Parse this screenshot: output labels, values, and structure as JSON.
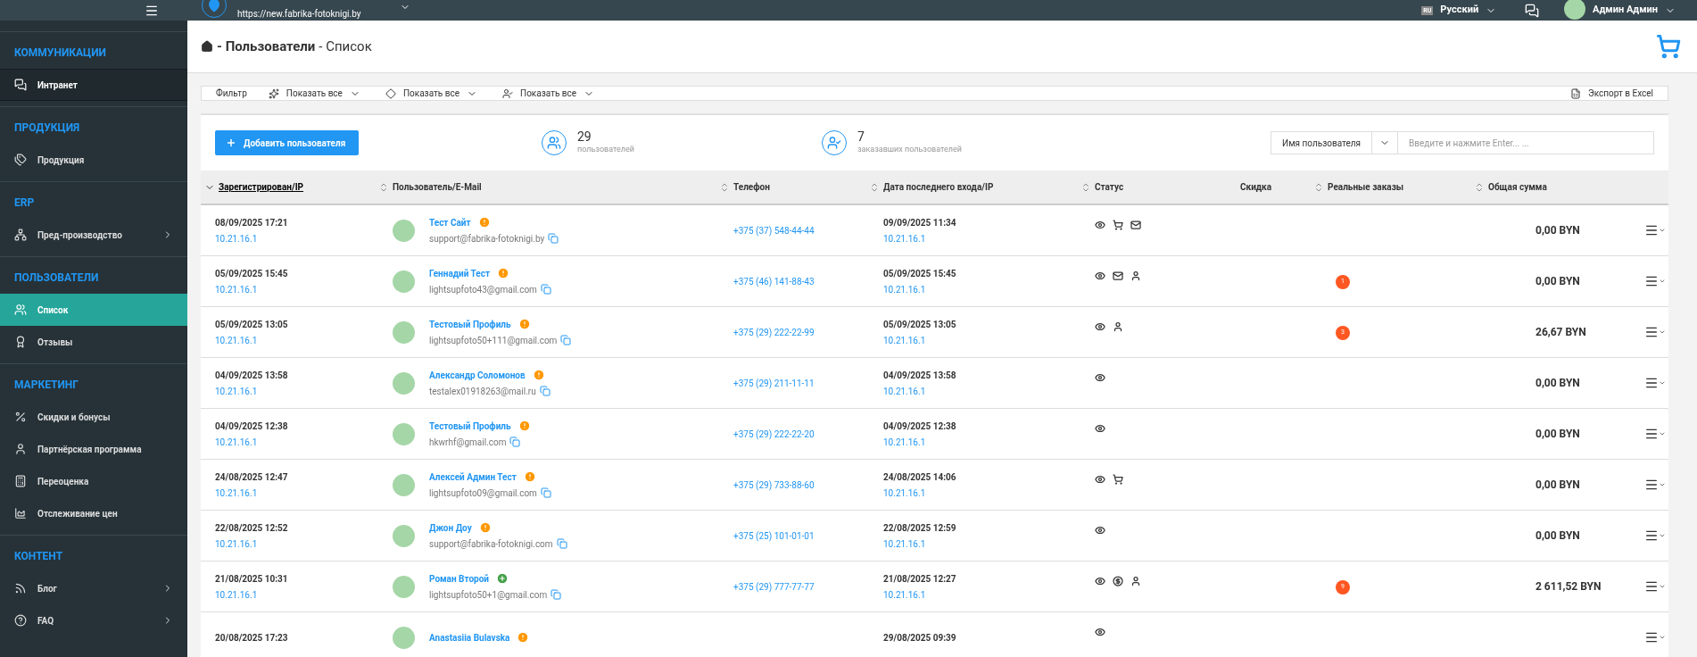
{
  "topbar": {
    "url": "https://new.fabrika-fotoknigi.by",
    "language_code": "RU",
    "language": "Русский",
    "user": "Админ Админ"
  },
  "sidebar": {
    "sections": [
      {
        "title": "КОММУНИКАЦИИ",
        "items": [
          {
            "label": "Интранет",
            "selected": false,
            "highlighted": true,
            "has_submenu": false
          }
        ]
      },
      {
        "title": "ПРОДУКЦИЯ",
        "items": [
          {
            "label": "Продукция",
            "selected": false,
            "highlighted": false,
            "has_submenu": false
          }
        ]
      },
      {
        "title": "ERP",
        "items": [
          {
            "label": "Пред-производство",
            "selected": false,
            "highlighted": false,
            "has_submenu": true
          }
        ]
      },
      {
        "title": "ПОЛЬЗОВАТЕЛИ",
        "items": [
          {
            "label": "Список",
            "selected": true,
            "highlighted": false,
            "has_submenu": false
          },
          {
            "label": "Отзывы",
            "selected": false,
            "highlighted": false,
            "has_submenu": false
          }
        ]
      },
      {
        "title": "МАРКЕТИНГ",
        "items": [
          {
            "label": "Скидки и бонусы",
            "selected": false,
            "highlighted": false,
            "has_submenu": false
          },
          {
            "label": "Партнёрская программа",
            "selected": false,
            "highlighted": false,
            "has_submenu": false
          },
          {
            "label": "Переоценка",
            "selected": false,
            "highlighted": false,
            "has_submenu": false
          },
          {
            "label": "Отслеживание цен",
            "selected": false,
            "highlighted": false,
            "has_submenu": false
          }
        ]
      },
      {
        "title": "КОНТЕНТ",
        "items": [
          {
            "label": "Блог",
            "selected": false,
            "highlighted": false,
            "has_submenu": true
          },
          {
            "label": "FAQ",
            "selected": false,
            "highlighted": false,
            "has_submenu": true
          }
        ]
      }
    ]
  },
  "breadcrumbs": [
    {
      "label": "- Пользователи",
      "current": false
    },
    {
      "label": "- Список",
      "current": true
    }
  ],
  "filter": {
    "label": "Фильтр",
    "dropdowns": [
      {
        "label": "Показать все"
      },
      {
        "label": "Показать все"
      },
      {
        "label": "Показать все"
      }
    ],
    "export": "Экспорт в Excel"
  },
  "add_button": "Добавить пользователя",
  "stats": [
    {
      "value": "29",
      "label": "пользователей"
    },
    {
      "value": "7",
      "label": "заказавших пользователей"
    }
  ],
  "search": {
    "field": "Имя пользователя",
    "placeholder": "Введите и нажмите Enter... ..."
  },
  "table": {
    "columns": [
      {
        "label": "Зарегистрирован/IP",
        "sortable": true,
        "sorted": true
      },
      {
        "label": "Пользователь/E-Mail",
        "sortable": true,
        "sorted": false
      },
      {
        "label": "Телефон",
        "sortable": true,
        "sorted": false
      },
      {
        "label": "Дата последнего входа/IP",
        "sortable": true,
        "sorted": false
      },
      {
        "label": "Статус",
        "sortable": true,
        "sorted": false
      },
      {
        "label": "Скидка",
        "sortable": false,
        "sorted": false
      },
      {
        "label": "Реальные заказы",
        "sortable": true,
        "sorted": false
      },
      {
        "label": "Общая сумма",
        "sortable": true,
        "sorted": false
      }
    ],
    "rows": [
      {
        "registered": "08/09/2025 17:21",
        "ip": "10.21.16.1",
        "name": "Тест Сайт",
        "flagged": true,
        "email": "support@fabrika-fotoknigi.by",
        "phone": "+375 (37) 548-44-44",
        "last_login": "09/09/2025 11:34",
        "last_ip": "10.21.16.1",
        "status": [
          {
            "kind": "view"
          },
          {
            "kind": "cart"
          },
          {
            "kind": "mail"
          }
        ],
        "orders": "",
        "total": "0,00 BYN"
      },
      {
        "registered": "05/09/2025 15:45",
        "ip": "10.21.16.1",
        "name": "Геннадий Тест",
        "flagged": true,
        "email": "lightsupfoto43@gmail.com",
        "phone": "+375 (46) 141-88-43",
        "last_login": "05/09/2025 15:45",
        "last_ip": "10.21.16.1",
        "status": [
          {
            "kind": "view"
          },
          {
            "kind": "mail"
          },
          {
            "kind": "person"
          }
        ],
        "orders": "1",
        "total": "0,00 BYN"
      },
      {
        "registered": "05/09/2025 13:05",
        "ip": "10.21.16.1",
        "name": "Тестовый Профиль",
        "flagged": true,
        "email": "lightsupfoto50+111@gmail.com",
        "phone": "+375 (29) 222-22-99",
        "last_login": "05/09/2025 13:05",
        "last_ip": "10.21.16.1",
        "status": [
          {
            "kind": "view"
          },
          {
            "kind": "person"
          }
        ],
        "orders": "3",
        "total": "26,67 BYN"
      },
      {
        "registered": "04/09/2025 13:58",
        "ip": "10.21.16.1",
        "name": "Александр Соломонов",
        "flagged": true,
        "email": "testalex01918263@mail.ru",
        "phone": "+375 (29) 211-11-11",
        "last_login": "04/09/2025 13:58",
        "last_ip": "10.21.16.1",
        "status": [
          {
            "kind": "view"
          }
        ],
        "orders": "",
        "total": "0,00 BYN"
      },
      {
        "registered": "04/09/2025 12:38",
        "ip": "10.21.16.1",
        "name": "Тестовый Профиль",
        "flagged": true,
        "email": "hkwrhf@gmail.com",
        "phone": "+375 (29) 222-22-20",
        "last_login": "04/09/2025 12:38",
        "last_ip": "10.21.16.1",
        "status": [
          {
            "kind": "view"
          }
        ],
        "orders": "",
        "total": "0,00 BYN"
      },
      {
        "registered": "24/08/2025 12:47",
        "ip": "10.21.16.1",
        "name": "Алексей Админ Тест",
        "flagged": true,
        "email": "lightsupfoto09@gmail.com",
        "phone": "+375 (29) 733-88-60",
        "last_login": "24/08/2025 14:06",
        "last_ip": "10.21.16.1",
        "status": [
          {
            "kind": "view"
          },
          {
            "kind": "cart"
          }
        ],
        "orders": "",
        "total": "0,00 BYN"
      },
      {
        "registered": "22/08/2025 12:52",
        "ip": "10.21.16.1",
        "name": "Джон Доу",
        "flagged": true,
        "email": "support@fabrika-fotoknigi.com",
        "phone": "+375 (25) 101-01-01",
        "last_login": "22/08/2025 12:59",
        "last_ip": "10.21.16.1",
        "status": [
          {
            "kind": "view"
          }
        ],
        "orders": "",
        "total": "0,00 BYN"
      },
      {
        "registered": "21/08/2025 10:31",
        "ip": "10.21.16.1",
        "name": "Роман Второй",
        "flagged": false,
        "email": "lightsupfoto50+1@gmail.com",
        "phone": "+375 (29) 777-77-77",
        "last_login": "21/08/2025 12:27",
        "last_ip": "10.21.16.1",
        "status": [
          {
            "kind": "view"
          },
          {
            "kind": "money"
          },
          {
            "kind": "person"
          }
        ],
        "orders": "9",
        "total": "2 611,52 BYN"
      },
      {
        "registered": "20/08/2025 17:23",
        "ip": "",
        "name": "Anastasiia Bulavska",
        "flagged": true,
        "email": "",
        "phone": "",
        "last_login": "29/08/2025 09:39",
        "last_ip": "",
        "status": [
          {
            "kind": "view"
          }
        ],
        "orders": "",
        "total": ""
      }
    ]
  }
}
